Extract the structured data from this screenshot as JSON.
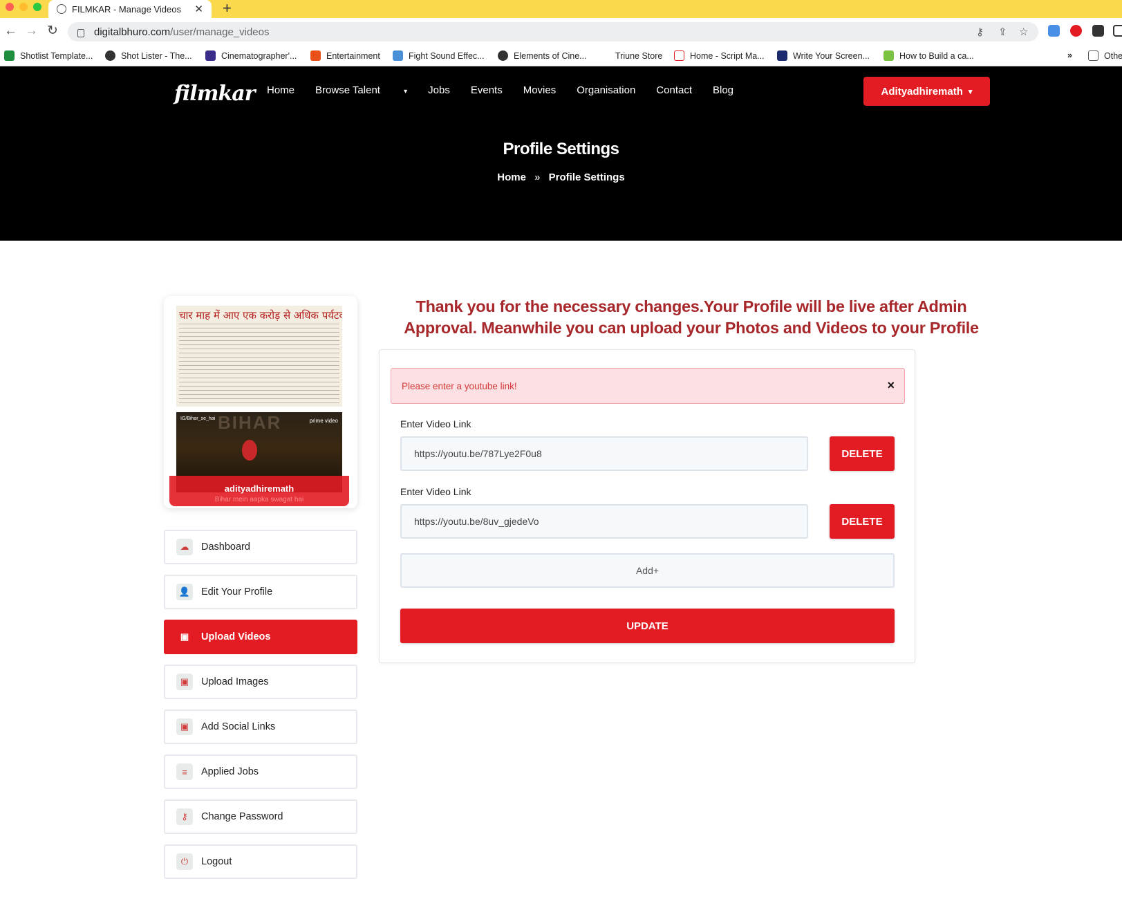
{
  "browser": {
    "tab_title": "FILMKAR - Manage Videos",
    "url_host": "digitalbhuro.com",
    "url_path": "/user/manage_videos",
    "bookmarks": [
      {
        "label": "Shotlist Template...",
        "icon_color": "#1e8e3e"
      },
      {
        "label": "Shot Lister - The...",
        "icon_color": "#333333"
      },
      {
        "label": "Cinematographer'...",
        "icon_color": "#3b2d8a"
      },
      {
        "label": "Entertainment",
        "icon_color": "#e8521a"
      },
      {
        "label": "Fight Sound Effec...",
        "icon_color": "#4a90d9"
      },
      {
        "label": "Elements of Cine...",
        "icon_color": "#333333"
      },
      {
        "label": "Triune Store",
        "icon_color": "#ffffff"
      },
      {
        "label": "Home - Script Ma...",
        "icon_color": "#e31b23"
      },
      {
        "label": "Write Your Screen...",
        "icon_color": "#1a2a6c"
      },
      {
        "label": "How to Build a ca...",
        "icon_color": "#7cc242"
      }
    ],
    "bookmarks_more": "»",
    "other_bookmarks": "Othe"
  },
  "site": {
    "logo_text": "filmkar",
    "nav": [
      "Home",
      "Browse Talent",
      "Jobs",
      "Events",
      "Movies",
      "Organisation",
      "Contact",
      "Blog"
    ],
    "user_button": "Adityadhiremath",
    "page_title": "Profile Settings",
    "breadcrumb_home": "Home",
    "breadcrumb_sep": "»",
    "breadcrumb_current": "Profile Settings"
  },
  "profile": {
    "news_headline": "चार माह में आए एक करोड़ से अधिक पर्यटक",
    "movie_title": "BIHAR",
    "movie_tag": "IG/Bihar_se_hai",
    "movie_badge": "prime video",
    "username": "adityadhiremath",
    "caption": "Bihar mein aapka swagat hai"
  },
  "sidebar": [
    {
      "label": "Dashboard",
      "icon": "dashboard-icon",
      "glyph": "☁",
      "active": false
    },
    {
      "label": "Edit Your Profile",
      "icon": "user-icon",
      "glyph": "👤",
      "active": false
    },
    {
      "label": "Upload Videos",
      "icon": "video-icon",
      "glyph": "▣",
      "active": true
    },
    {
      "label": "Upload Images",
      "icon": "image-icon",
      "glyph": "▣",
      "active": false
    },
    {
      "label": "Add Social Links",
      "icon": "link-icon",
      "glyph": "▣",
      "active": false
    },
    {
      "label": "Applied Jobs",
      "icon": "list-icon",
      "glyph": "≡",
      "active": false
    },
    {
      "label": "Change Password",
      "icon": "key-icon",
      "glyph": "⚷",
      "active": false
    },
    {
      "label": "Logout",
      "icon": "power-icon",
      "glyph": "⏻",
      "active": false
    }
  ],
  "notice": "Thank you for the necessary changes.Your Profile will be live after Admin Approval. Meanwhile you can upload your Photos and Videos to your Profile",
  "form": {
    "alert": "Please enter a youtube link!",
    "alert_close": "×",
    "videos": [
      {
        "label": "Enter Video Link",
        "value": "https://youtu.be/787Lye2F0u8",
        "delete_label": "DELETE"
      },
      {
        "label": "Enter Video Link",
        "value": "https://youtu.be/8uv_gjedeVo",
        "delete_label": "DELETE"
      }
    ],
    "add_label": "Add+",
    "update_label": "UPDATE"
  },
  "colors": {
    "brand_red": "#e31b23",
    "notice_red": "#a8272b",
    "alert_bg": "#fde0e3",
    "chrome_yellow": "#fbd94d"
  }
}
